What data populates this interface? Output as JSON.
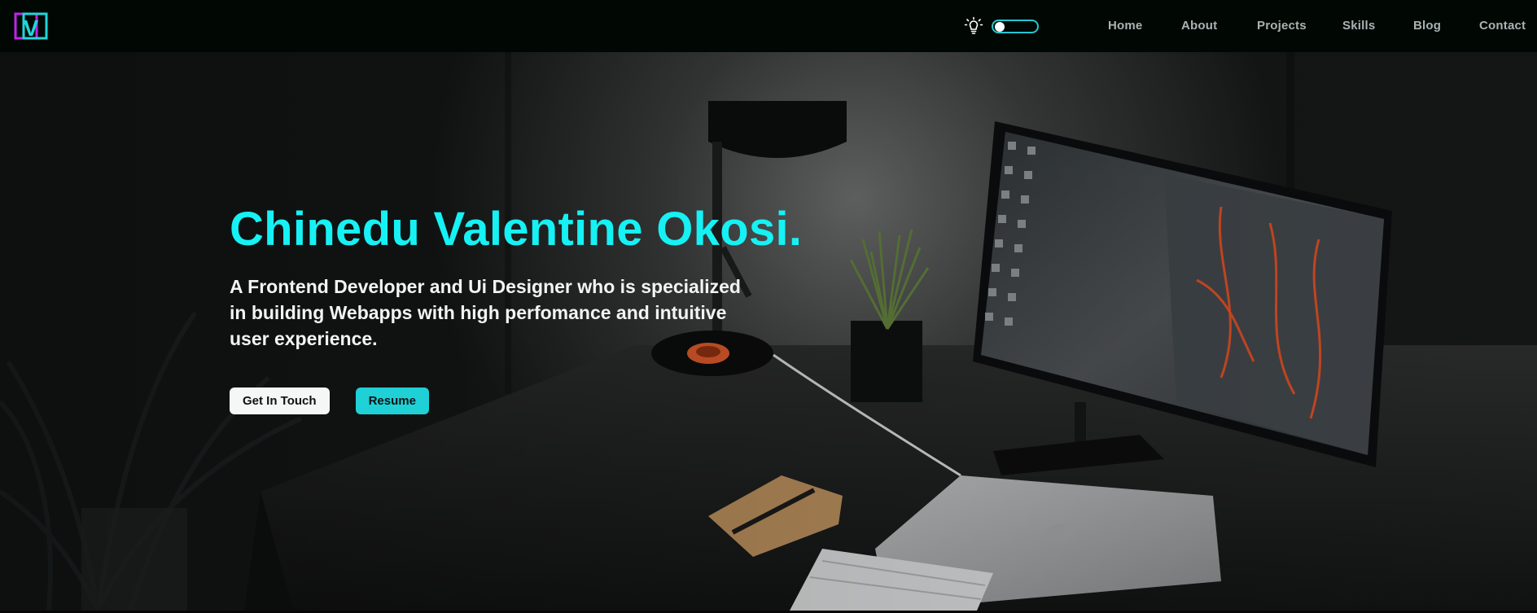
{
  "brand": {
    "logo_letter": "V",
    "colors": {
      "logo_cyan": "#1fd6d9",
      "logo_magenta": "#c423e8"
    }
  },
  "theme_toggle": {
    "icon": "lightbulb-icon",
    "state": "off"
  },
  "nav": {
    "links": [
      {
        "label": "Home"
      },
      {
        "label": "About"
      },
      {
        "label": "Projects"
      },
      {
        "label": "Skills"
      },
      {
        "label": "Blog"
      },
      {
        "label": "Contact"
      }
    ]
  },
  "hero": {
    "title": "Chinedu Valentine Okosi.",
    "subtitle": "A Frontend Developer and Ui Designer who is specialized in building Webapps with high perfomance and intuitive user experience.",
    "buttons": {
      "primary": "Get In Touch",
      "secondary": "Resume"
    },
    "colors": {
      "accent": "#16f1f4",
      "button_accent": "#1fd1d6"
    }
  }
}
